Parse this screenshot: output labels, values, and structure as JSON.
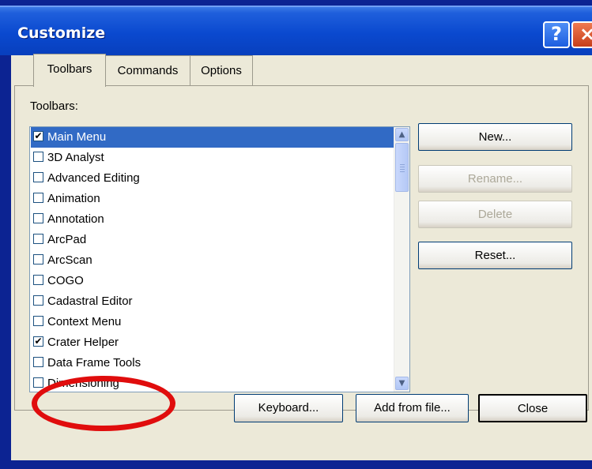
{
  "window": {
    "title": "Customize",
    "help_button": "?",
    "close_button": "×"
  },
  "tabs": [
    {
      "label": "Toolbars",
      "active": true
    },
    {
      "label": "Commands",
      "active": false
    },
    {
      "label": "Options",
      "active": false
    }
  ],
  "toolbars_label": "Toolbars:",
  "toolbar_list": [
    {
      "label": "Main Menu",
      "checked": true,
      "selected": true
    },
    {
      "label": "3D Analyst",
      "checked": false
    },
    {
      "label": "Advanced Editing",
      "checked": false
    },
    {
      "label": "Animation",
      "checked": false
    },
    {
      "label": "Annotation",
      "checked": false
    },
    {
      "label": "ArcPad",
      "checked": false
    },
    {
      "label": "ArcScan",
      "checked": false
    },
    {
      "label": "COGO",
      "checked": false
    },
    {
      "label": "Cadastral Editor",
      "checked": false
    },
    {
      "label": "Context Menu",
      "checked": false
    },
    {
      "label": "Crater Helper",
      "checked": true,
      "highlighted": true
    },
    {
      "label": "Data Frame Tools",
      "checked": false
    },
    {
      "label": "Dimensioning",
      "checked": false
    }
  ],
  "checkmark": "✔",
  "side_buttons": {
    "new": "New...",
    "rename": "Rename...",
    "delete": "Delete",
    "reset": "Reset..."
  },
  "bottom_buttons": {
    "keyboard": "Keyboard...",
    "add_from_file": "Add from file...",
    "close": "Close"
  },
  "icons": {
    "scroll_up": "▲",
    "scroll_down": "▼"
  },
  "colors": {
    "title_bar": "#0a49cf",
    "selection": "#316ac5",
    "annotation_circle": "#e00d0d"
  }
}
